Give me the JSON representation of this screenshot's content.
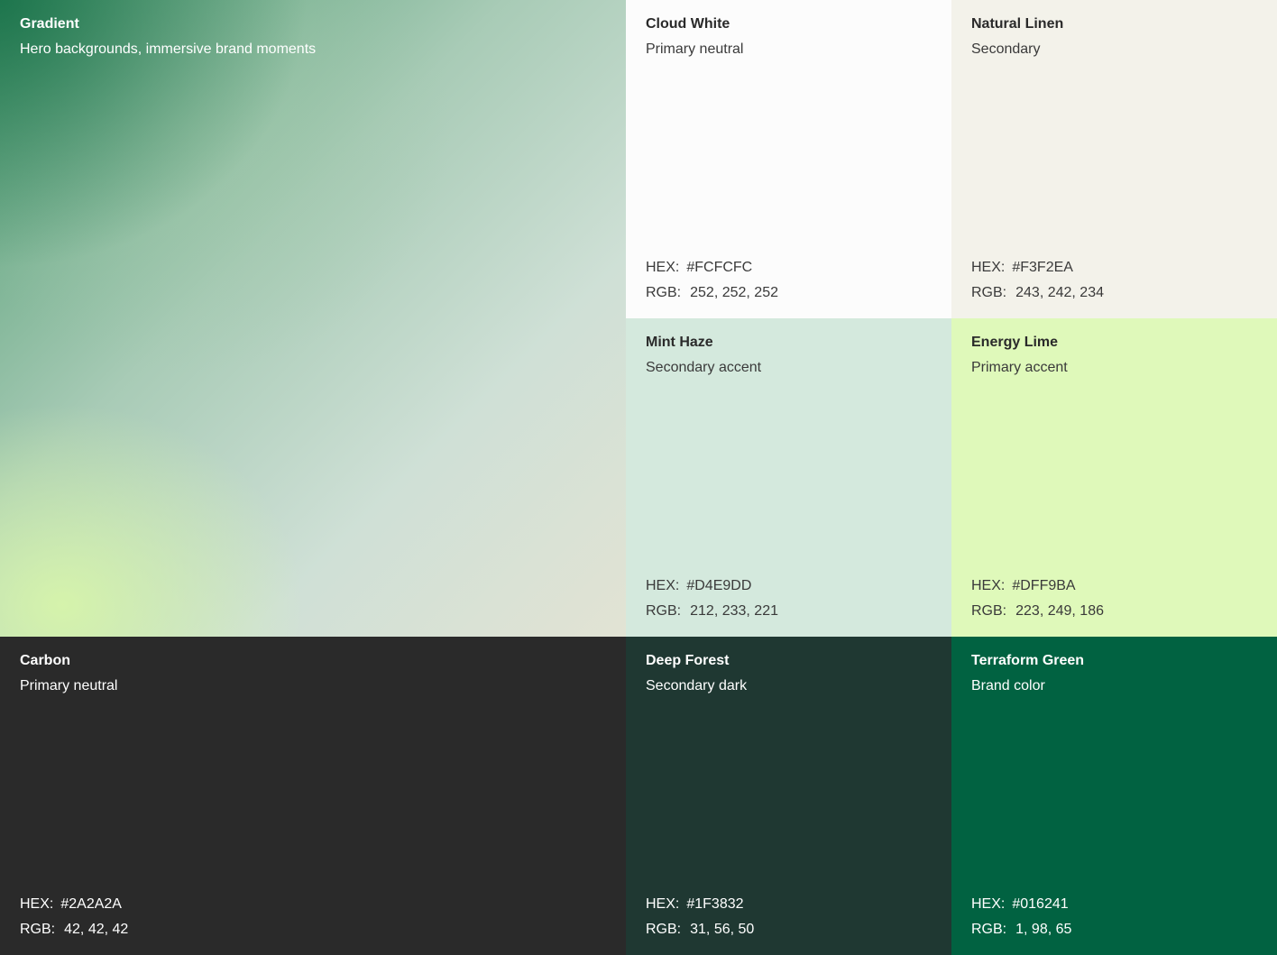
{
  "gradient": {
    "name": "Gradient",
    "role": "Hero backgrounds, immersive brand moments"
  },
  "labels": {
    "hex": "HEX:",
    "rgb": "RGB:"
  },
  "swatches": {
    "cloud_white": {
      "name": "Cloud White",
      "role": "Primary neutral",
      "hex": "#FCFCFC",
      "rgb": "252, 252, 252",
      "color": "#FCFCFC"
    },
    "natural_linen": {
      "name": "Natural Linen",
      "role": "Secondary",
      "hex": "#F3F2EA",
      "rgb": "243, 242, 234",
      "color": "#F3F2EA"
    },
    "mint_haze": {
      "name": "Mint Haze",
      "role": "Secondary accent",
      "hex": "#D4E9DD",
      "rgb": "212, 233, 221",
      "color": "#D4E9DD"
    },
    "energy_lime": {
      "name": "Energy Lime",
      "role": "Primary accent",
      "hex": "#DFF9BA",
      "rgb": "223, 249, 186",
      "color": "#DFF9BA"
    },
    "carbon": {
      "name": "Carbon",
      "role": "Primary neutral",
      "hex": "#2A2A2A",
      "rgb": "42, 42, 42",
      "color": "#2A2A2A"
    },
    "deep_forest": {
      "name": "Deep Forest",
      "role": "Secondary dark",
      "hex": "#1F3832",
      "rgb": "31, 56, 50",
      "color": "#1F3832"
    },
    "terraform_green": {
      "name": "Terraform Green",
      "role": "Brand color",
      "hex": "#016241",
      "rgb": "1, 98, 65",
      "color": "#016241"
    }
  }
}
